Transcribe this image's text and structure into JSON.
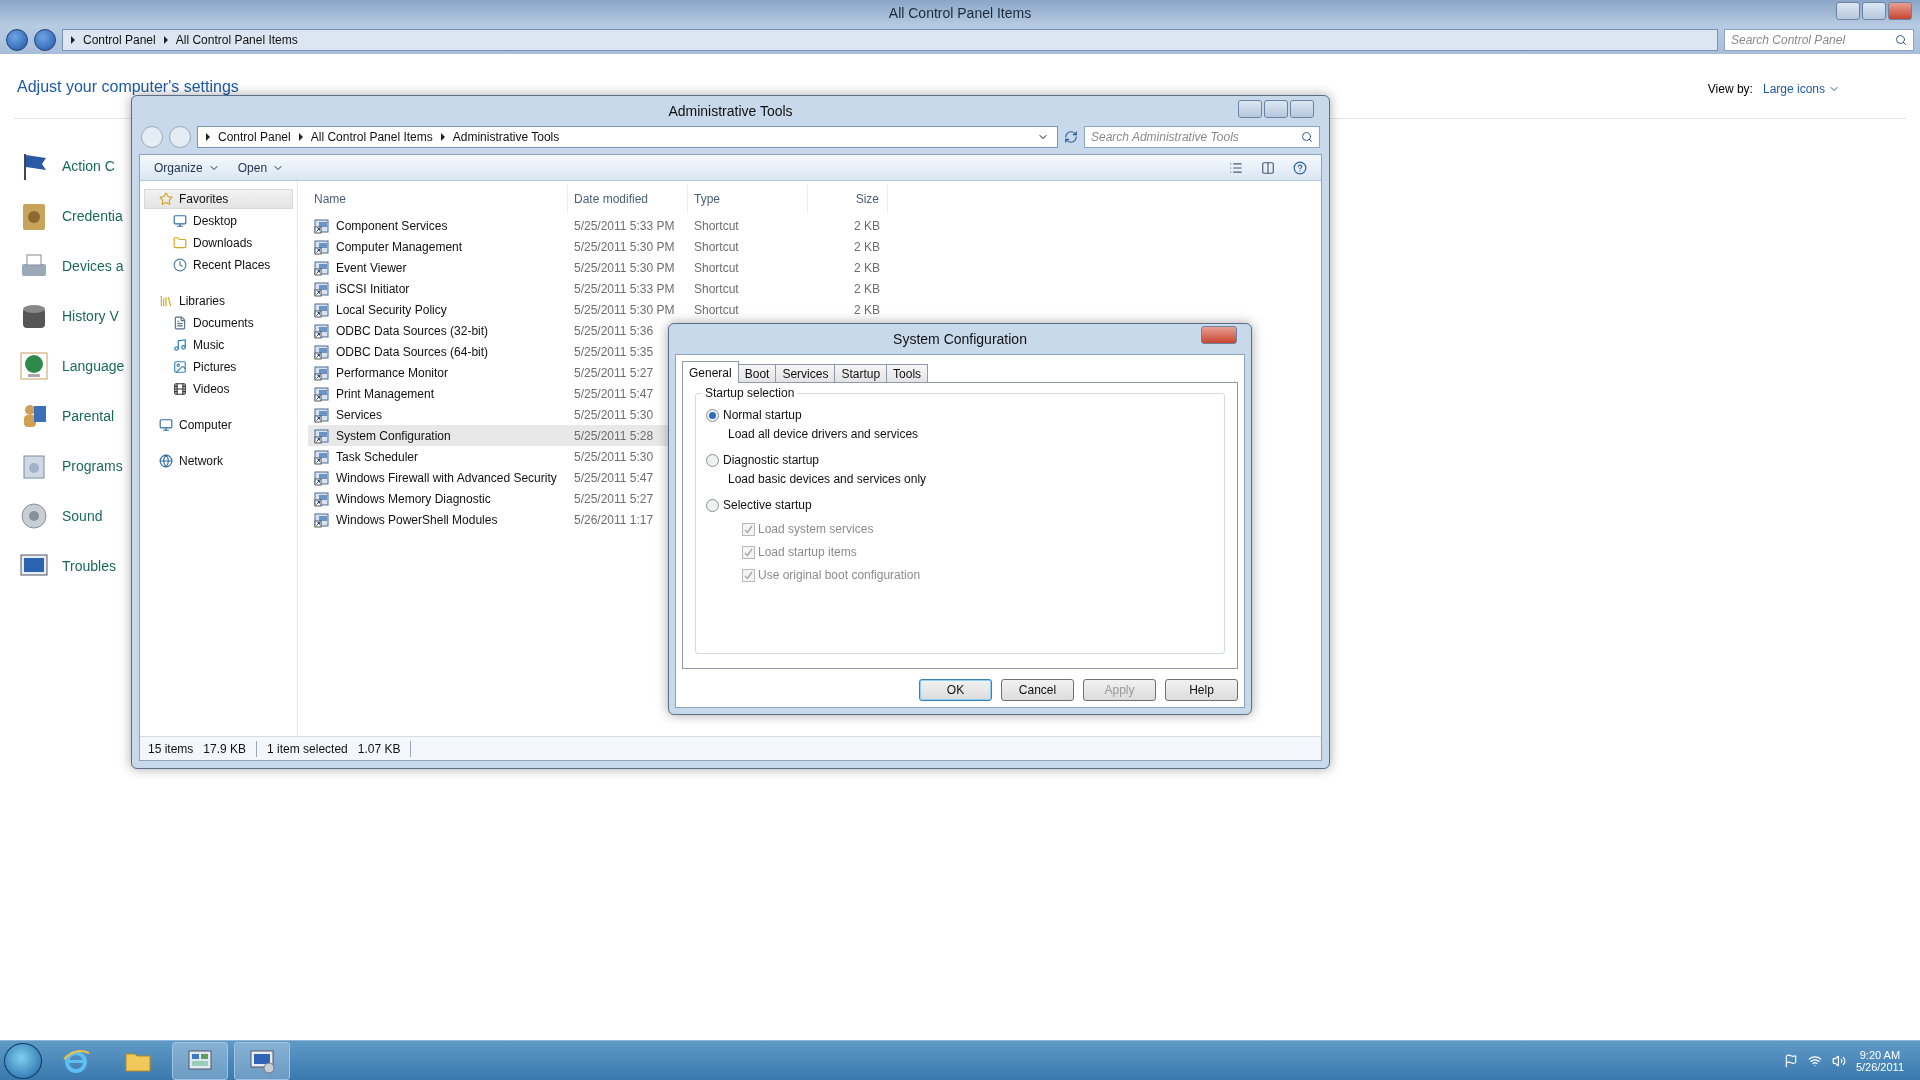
{
  "main_window": {
    "title": "All Control Panel Items",
    "breadcrumbs": [
      "Control Panel",
      "All Control Panel Items"
    ],
    "search": {
      "placeholder": "Search Control Panel"
    },
    "heading": "Adjust your computer's settings",
    "view_by": {
      "label": "View by:",
      "value": "Large icons"
    },
    "items": [
      {
        "label": "Action C"
      },
      {
        "label": "Credentia"
      },
      {
        "label": "Devices a"
      },
      {
        "label": "History V"
      },
      {
        "label": "Language"
      },
      {
        "label": "Parental"
      },
      {
        "label": "Programs"
      },
      {
        "label": "Sound"
      },
      {
        "label": "Troubles"
      }
    ]
  },
  "explorer": {
    "title": "Administrative Tools",
    "breadcrumbs": [
      "Control Panel",
      "All Control Panel Items",
      "Administrative Tools"
    ],
    "search": {
      "placeholder": "Search Administrative Tools"
    },
    "toolbar": [
      "Organize",
      "Open"
    ],
    "nav": [
      {
        "label": "Favorites",
        "selected": true,
        "children": [
          {
            "label": "Desktop",
            "selected": false
          },
          {
            "label": "Downloads",
            "selected": false
          },
          {
            "label": "Recent Places",
            "selected": false
          }
        ]
      },
      {
        "label": "Libraries",
        "selected": false,
        "children": [
          {
            "label": "Documents",
            "selected": false
          },
          {
            "label": "Music",
            "selected": false
          },
          {
            "label": "Pictures",
            "selected": false
          },
          {
            "label": "Videos",
            "selected": false
          }
        ]
      },
      {
        "label": "Computer",
        "selected": false
      },
      {
        "label": "Network",
        "selected": false
      }
    ],
    "columns": [
      "Name",
      "Date modified",
      "Type",
      "Size"
    ],
    "rows": [
      {
        "name": "Component Services",
        "date": "5/25/2011 5:33 PM",
        "type": "Shortcut",
        "size": "2 KB",
        "selected": false
      },
      {
        "name": "Computer Management",
        "date": "5/25/2011 5:30 PM",
        "type": "Shortcut",
        "size": "2 KB",
        "selected": false
      },
      {
        "name": "Event Viewer",
        "date": "5/25/2011 5:30 PM",
        "type": "Shortcut",
        "size": "2 KB",
        "selected": false
      },
      {
        "name": "iSCSI Initiator",
        "date": "5/25/2011 5:33 PM",
        "type": "Shortcut",
        "size": "2 KB",
        "selected": false
      },
      {
        "name": "Local Security Policy",
        "date": "5/25/2011 5:30 PM",
        "type": "Shortcut",
        "size": "2 KB",
        "selected": false
      },
      {
        "name": "ODBC Data Sources (32-bit)",
        "date": "5/25/2011 5:36",
        "selected": false
      },
      {
        "name": "ODBC Data Sources (64-bit)",
        "date": "5/25/2011 5:35",
        "selected": false
      },
      {
        "name": "Performance Monitor",
        "date": "5/25/2011 5:27",
        "selected": false
      },
      {
        "name": "Print Management",
        "date": "5/25/2011 5:47",
        "selected": false
      },
      {
        "name": "Services",
        "date": "5/25/2011 5:30",
        "selected": false
      },
      {
        "name": "System Configuration",
        "date": "5/25/2011 5:28",
        "selected": true
      },
      {
        "name": "Task Scheduler",
        "date": "5/25/2011 5:30",
        "selected": false
      },
      {
        "name": "Windows Firewall with Advanced Security",
        "date": "5/25/2011 5:47",
        "selected": false
      },
      {
        "name": "Windows Memory Diagnostic",
        "date": "5/25/2011 5:27",
        "selected": false
      },
      {
        "name": "Windows PowerShell Modules",
        "date": "5/26/2011 1:17",
        "selected": false
      }
    ],
    "status": [
      "15 items",
      "17.9 KB",
      "1 item selected",
      "1.07 KB"
    ]
  },
  "dialog": {
    "title": "System Configuration",
    "tabs": [
      {
        "label": "General",
        "selected": true
      },
      {
        "label": "Boot",
        "selected": false
      },
      {
        "label": "Services",
        "selected": false
      },
      {
        "label": "Startup",
        "selected": false
      },
      {
        "label": "Tools",
        "selected": false
      }
    ],
    "group": "Startup selection",
    "options": [
      {
        "label": "Normal startup",
        "description": "Load all device drivers and services",
        "selected": true
      },
      {
        "label": "Diagnostic startup",
        "description": "Load basic devices and services only",
        "selected": false
      },
      {
        "label": "Selective startup",
        "selected": false
      }
    ],
    "checkboxes": [
      {
        "label": "Load system services",
        "checked": true,
        "disabled": true
      },
      {
        "label": "Load startup items",
        "checked": true,
        "disabled": true
      },
      {
        "label": "Use original boot configuration",
        "checked": true,
        "disabled": true
      }
    ],
    "buttons": [
      {
        "label": "OK",
        "disabled": false,
        "default": true
      },
      {
        "label": "Cancel",
        "disabled": false,
        "default": false
      },
      {
        "label": "Apply",
        "disabled": true,
        "default": false
      },
      {
        "label": "Help",
        "disabled": false,
        "default": false
      }
    ]
  },
  "taskbar": {
    "apps": [
      {
        "kind": "browser",
        "running": false
      },
      {
        "kind": "folder",
        "running": false
      },
      {
        "kind": "control-panel",
        "running": true
      },
      {
        "kind": "config",
        "running": true
      }
    ],
    "time": "9:20 AM",
    "date": "5/26/2011"
  }
}
